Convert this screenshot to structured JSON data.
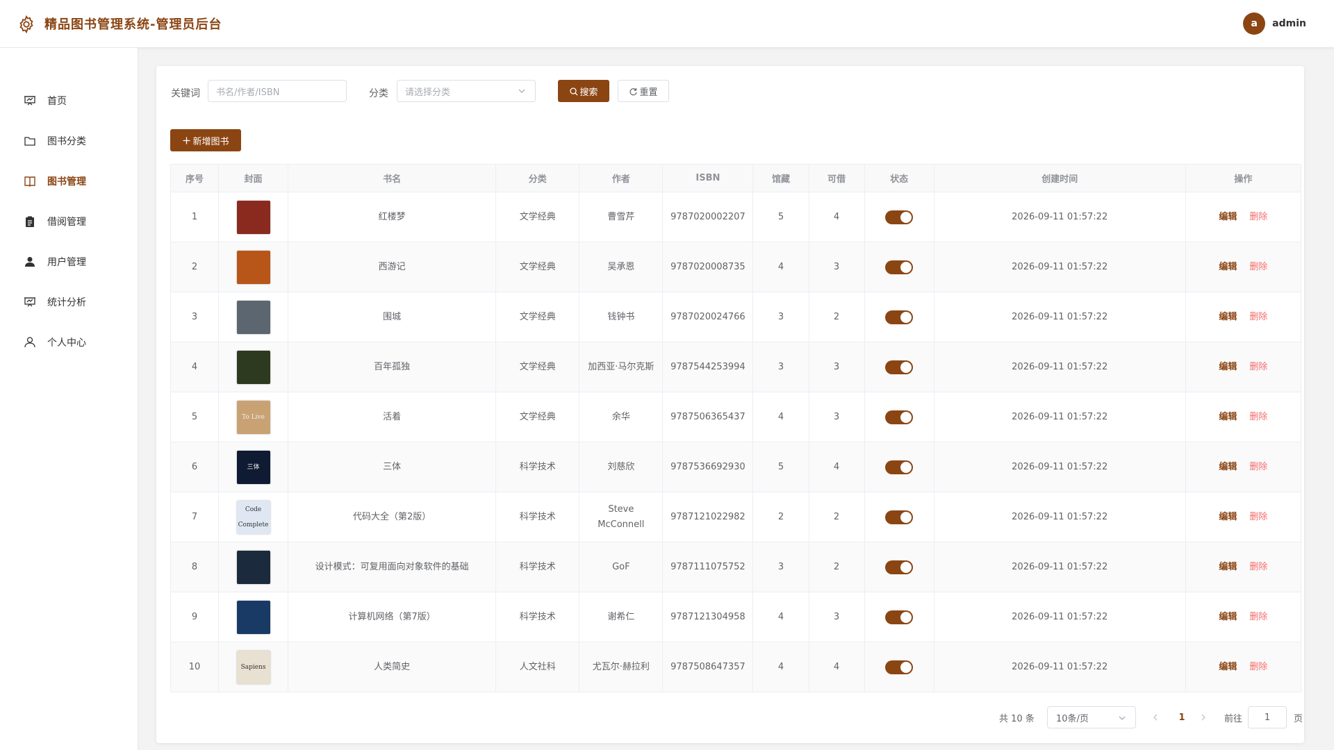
{
  "app": {
    "title": "精品图书管理系统-管理员后台"
  },
  "user": {
    "avatar_letter": "a",
    "name": "admin"
  },
  "sidebar": {
    "items": [
      {
        "label": "首页",
        "icon": "dashboard-icon",
        "active": false
      },
      {
        "label": "图书分类",
        "icon": "folder-icon",
        "active": false
      },
      {
        "label": "图书管理",
        "icon": "book-icon",
        "active": true
      },
      {
        "label": "借阅管理",
        "icon": "clipboard-icon",
        "active": false
      },
      {
        "label": "用户管理",
        "icon": "user-filled-icon",
        "active": false
      },
      {
        "label": "统计分析",
        "icon": "presentation-chart-icon",
        "active": false
      },
      {
        "label": "个人中心",
        "icon": "user-outline-icon",
        "active": false
      }
    ]
  },
  "search": {
    "keyword_label": "关键词",
    "keyword_placeholder": "书名/作者/ISBN",
    "category_label": "分类",
    "category_placeholder": "请选择分类",
    "search_button": "搜索",
    "reset_button": "重置"
  },
  "toolbar": {
    "add_button": "新增图书"
  },
  "table": {
    "headers": [
      "序号",
      "封面",
      "书名",
      "分类",
      "作者",
      "ISBN",
      "馆藏",
      "可借",
      "状态",
      "创建时间",
      "操作"
    ],
    "edit_label": "编辑",
    "delete_label": "删除",
    "rows": [
      {
        "index": "1",
        "title": "红楼梦",
        "category": "文学经典",
        "author": "曹雪芹",
        "isbn": "9787020002207",
        "stock": "5",
        "available": "4",
        "status": true,
        "created": "2026-09-11 01:57:22",
        "cover_color": "#8a2a1e",
        "cover_text": ""
      },
      {
        "index": "2",
        "title": "西游记",
        "category": "文学经典",
        "author": "吴承恩",
        "isbn": "9787020008735",
        "stock": "4",
        "available": "3",
        "status": true,
        "created": "2026-09-11 01:57:22",
        "cover_color": "#b8561a",
        "cover_text": ""
      },
      {
        "index": "3",
        "title": "围城",
        "category": "文学经典",
        "author": "钱钟书",
        "isbn": "9787020024766",
        "stock": "3",
        "available": "2",
        "status": true,
        "created": "2026-09-11 01:57:22",
        "cover_color": "#5c6670",
        "cover_text": ""
      },
      {
        "index": "4",
        "title": "百年孤独",
        "category": "文学经典",
        "author": "加西亚·马尔克斯",
        "isbn": "9787544253994",
        "stock": "3",
        "available": "3",
        "status": true,
        "created": "2026-09-11 01:57:22",
        "cover_color": "#2e3a1f",
        "cover_text": ""
      },
      {
        "index": "5",
        "title": "活着",
        "category": "文学经典",
        "author": "余华",
        "isbn": "9787506365437",
        "stock": "4",
        "available": "3",
        "status": true,
        "created": "2026-09-11 01:57:22",
        "cover_color": "#c9a274",
        "cover_text": "To Live"
      },
      {
        "index": "6",
        "title": "三体",
        "category": "科学技术",
        "author": "刘慈欣",
        "isbn": "9787536692930",
        "stock": "5",
        "available": "4",
        "status": true,
        "created": "2026-09-11 01:57:22",
        "cover_color": "#0f1a33",
        "cover_text": "三体"
      },
      {
        "index": "7",
        "title": "代码大全（第2版）",
        "category": "科学技术",
        "author": "Steve McConnell",
        "isbn": "9787121022982",
        "stock": "2",
        "available": "2",
        "status": true,
        "created": "2026-09-11 01:57:22",
        "cover_color": "#dfe8f2",
        "cover_text": "Code Complete"
      },
      {
        "index": "8",
        "title": "设计模式：可复用面向对象软件的基础",
        "category": "科学技术",
        "author": "GoF",
        "isbn": "9787111075752",
        "stock": "3",
        "available": "2",
        "status": true,
        "created": "2026-09-11 01:57:22",
        "cover_color": "#1c2a3e",
        "cover_text": ""
      },
      {
        "index": "9",
        "title": "计算机网络（第7版）",
        "category": "科学技术",
        "author": "谢希仁",
        "isbn": "9787121304958",
        "stock": "4",
        "available": "3",
        "status": true,
        "created": "2026-09-11 01:57:22",
        "cover_color": "#1a3a66",
        "cover_text": ""
      },
      {
        "index": "10",
        "title": "人类简史",
        "category": "人文社科",
        "author": "尤瓦尔·赫拉利",
        "isbn": "9787508647357",
        "stock": "4",
        "available": "4",
        "status": true,
        "created": "2026-09-11 01:57:22",
        "cover_color": "#e8e0d0",
        "cover_text": "Sapiens"
      }
    ]
  },
  "pagination": {
    "total": "共 10 条",
    "page_size": "10条/页",
    "current_page": "1",
    "goto_label": "前往",
    "goto_value": "1",
    "page_unit": "页"
  },
  "colors": {
    "accent": "#8b4513",
    "danger": "#f56c6c"
  }
}
